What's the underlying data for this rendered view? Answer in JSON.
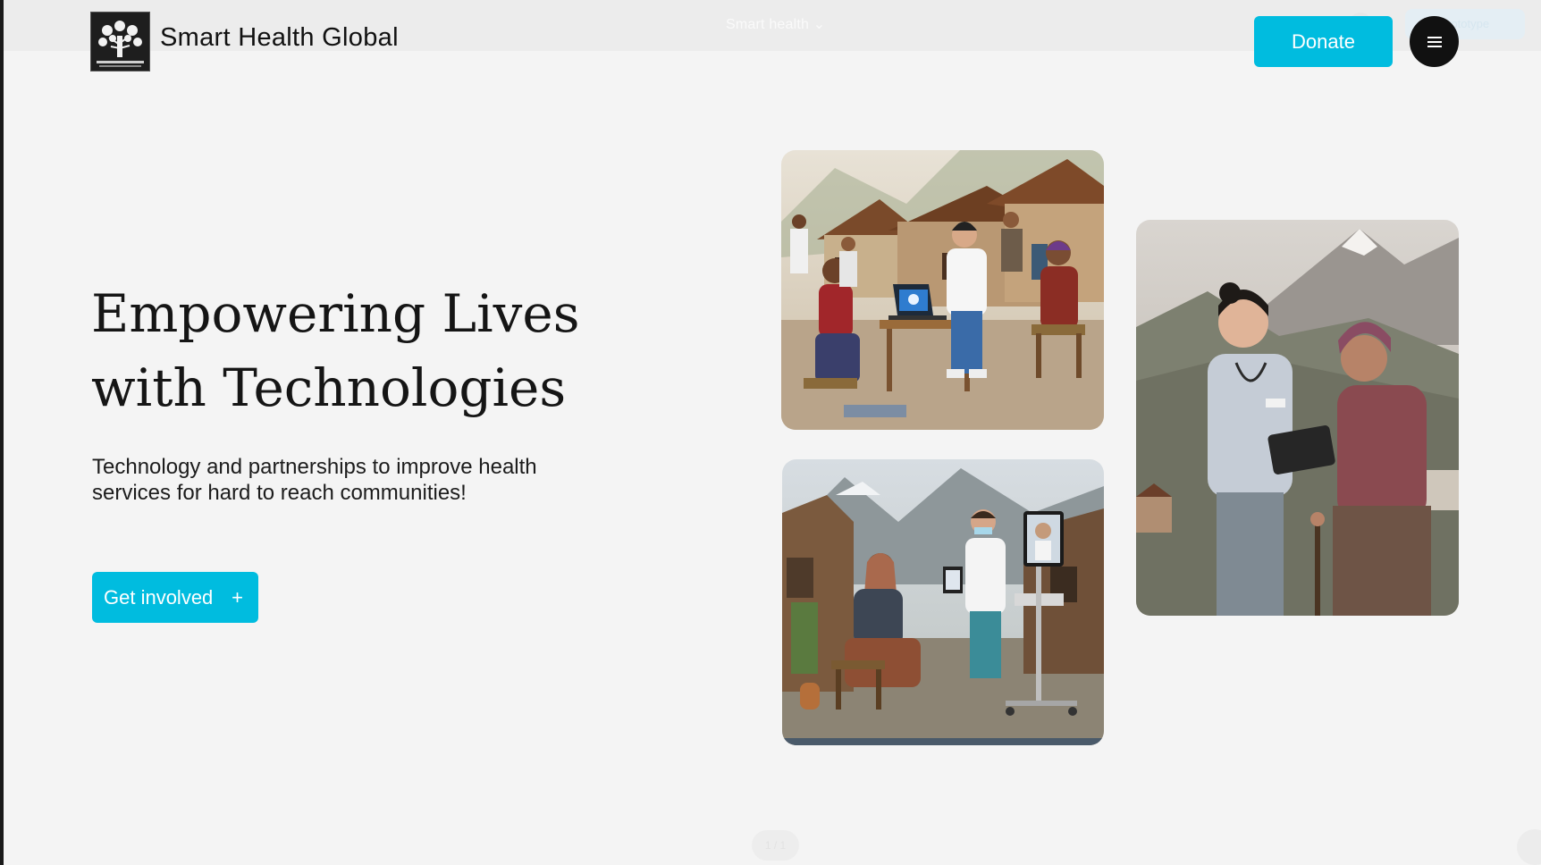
{
  "header": {
    "brand": "Smart Health Global",
    "ghost_title": "Smart health ⌄",
    "ghost_pill": "prototype",
    "donate_label": "Donate",
    "logo_text": "SMART HEALTH GLOBAL"
  },
  "hero": {
    "headline_line1": "Empowering Lives",
    "headline_line2": "with Technologies",
    "subtext": "Technology and partnerships to improve health services for hard to reach communities!",
    "cta_label": "Get involved",
    "cta_icon": "+"
  },
  "gallery": {
    "images": [
      {
        "name": "village-clinic-laptop-photo"
      },
      {
        "name": "telemedicine-cart-photo"
      },
      {
        "name": "nurse-tablet-elder-photo"
      }
    ]
  },
  "pager": {
    "label": "1 / 1"
  },
  "colors": {
    "accent": "#00bcdf",
    "background": "#f4f4f4",
    "text": "#111111"
  }
}
